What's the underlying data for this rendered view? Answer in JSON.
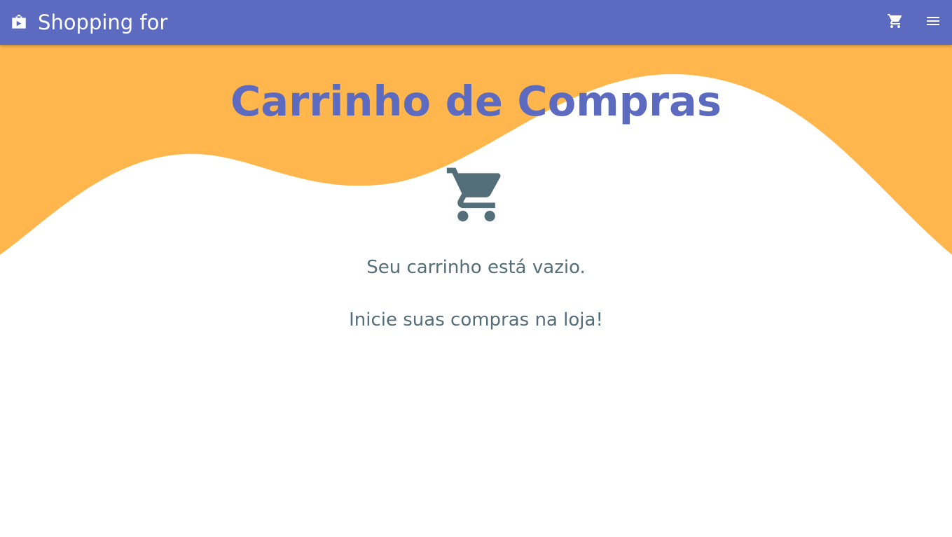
{
  "appbar": {
    "title": "Shopping for",
    "brand_icon": "shop-bag-icon",
    "actions": [
      {
        "name": "cart",
        "icon": "shopping-cart-icon"
      },
      {
        "name": "menu",
        "icon": "hamburger-menu-icon"
      }
    ]
  },
  "page": {
    "title": "Carrinho de Compras",
    "empty_icon": "shopping-cart-icon",
    "empty_message": "Seu carrinho está vazio.",
    "empty_cta": "Inicie suas compras na loja!"
  },
  "colors": {
    "appbar": "#5c6bc0",
    "title": "#5c6bc0",
    "wave": "#ffb74d",
    "text": "#546e7a",
    "background": "#ffffff"
  }
}
